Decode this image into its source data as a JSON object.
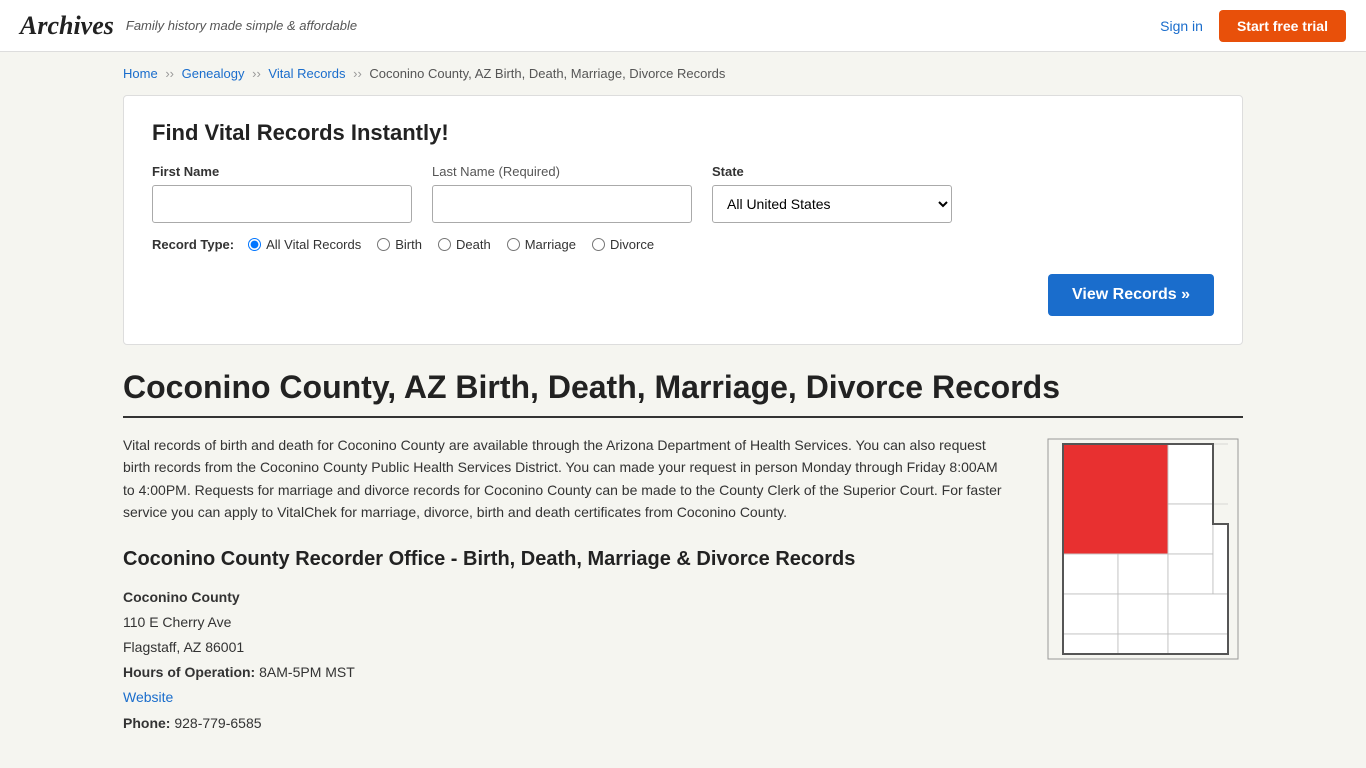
{
  "header": {
    "logo": "Archives",
    "tagline": "Family history made simple & affordable",
    "signin_label": "Sign in",
    "trial_label": "Start free trial"
  },
  "breadcrumb": {
    "home": "Home",
    "genealogy": "Genealogy",
    "vital_records": "Vital Records",
    "current": "Coconino County, AZ Birth, Death, Marriage, Divorce Records"
  },
  "search": {
    "title": "Find Vital Records Instantly!",
    "first_name_label": "First Name",
    "last_name_label": "Last Name",
    "last_name_required": "(Required)",
    "state_label": "State",
    "state_default": "All United States",
    "record_type_label": "Record Type:",
    "record_types": [
      {
        "id": "all",
        "label": "All Vital Records",
        "checked": true
      },
      {
        "id": "birth",
        "label": "Birth",
        "checked": false
      },
      {
        "id": "death",
        "label": "Death",
        "checked": false
      },
      {
        "id": "marriage",
        "label": "Marriage",
        "checked": false
      },
      {
        "id": "divorce",
        "label": "Divorce",
        "checked": false
      }
    ],
    "view_records_label": "View Records »"
  },
  "page": {
    "title": "Coconino County, AZ Birth, Death, Marriage, Divorce Records",
    "description": "Vital records of birth and death for Coconino County are available through the Arizona Department of Health Services. You can also request birth records from the Coconino County Public Health Services District. You can made your request in person Monday through Friday 8:00AM to 4:00PM. Requests for marriage and divorce records for Coconino County can be made to the County Clerk of the Superior Court. For faster service you can apply to VitalChek for marriage, divorce, birth and death certificates from Coconino County.",
    "recorder_title": "Coconino County Recorder Office - Birth, Death, Marriage & Divorce Records",
    "office": {
      "name": "Coconino County",
      "address1": "110 E Cherry Ave",
      "address2": "Flagstaff, AZ 86001",
      "hours_label": "Hours of Operation:",
      "hours_value": "8AM-5PM MST",
      "website_label": "Website",
      "phone_label": "Phone:",
      "phone_value": "928-779-6585"
    }
  }
}
